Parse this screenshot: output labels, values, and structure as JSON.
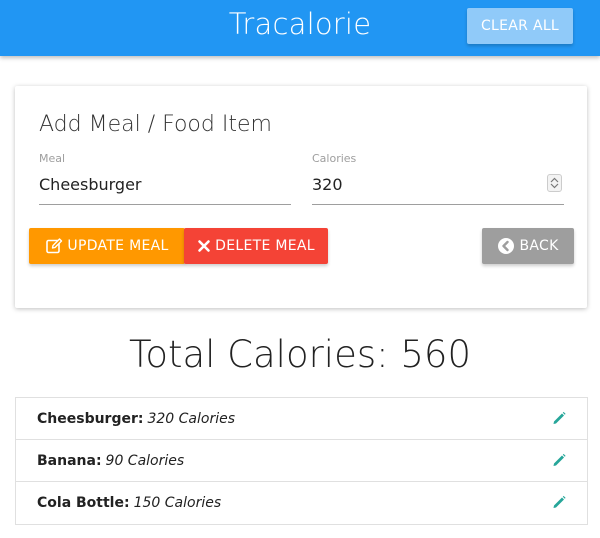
{
  "navbar": {
    "brand": "Tracalorie",
    "clear_all_label": "CLEAR ALL",
    "color": "#2196f3"
  },
  "form": {
    "title": "Add Meal / Food Item",
    "meal": {
      "label": "Meal",
      "value": "Cheesburger"
    },
    "calories": {
      "label": "Calories",
      "value": "320"
    },
    "update_label": "UPDATE MEAL",
    "delete_label": "DELETE MEAL",
    "back_label": "BACK",
    "colors": {
      "update": "#ff9800",
      "delete": "#f44336",
      "back": "#9e9e9e"
    }
  },
  "total": {
    "text": "Total Calories: 560"
  },
  "items": [
    {
      "name": "Cheesburger:",
      "calories": "320 Calories",
      "icon": "pencil-icon"
    },
    {
      "name": "Banana:",
      "calories": "90 Calories",
      "icon": "pencil-icon"
    },
    {
      "name": "Cola Bottle:",
      "calories": "150 Calories",
      "icon": "pencil-icon"
    }
  ]
}
